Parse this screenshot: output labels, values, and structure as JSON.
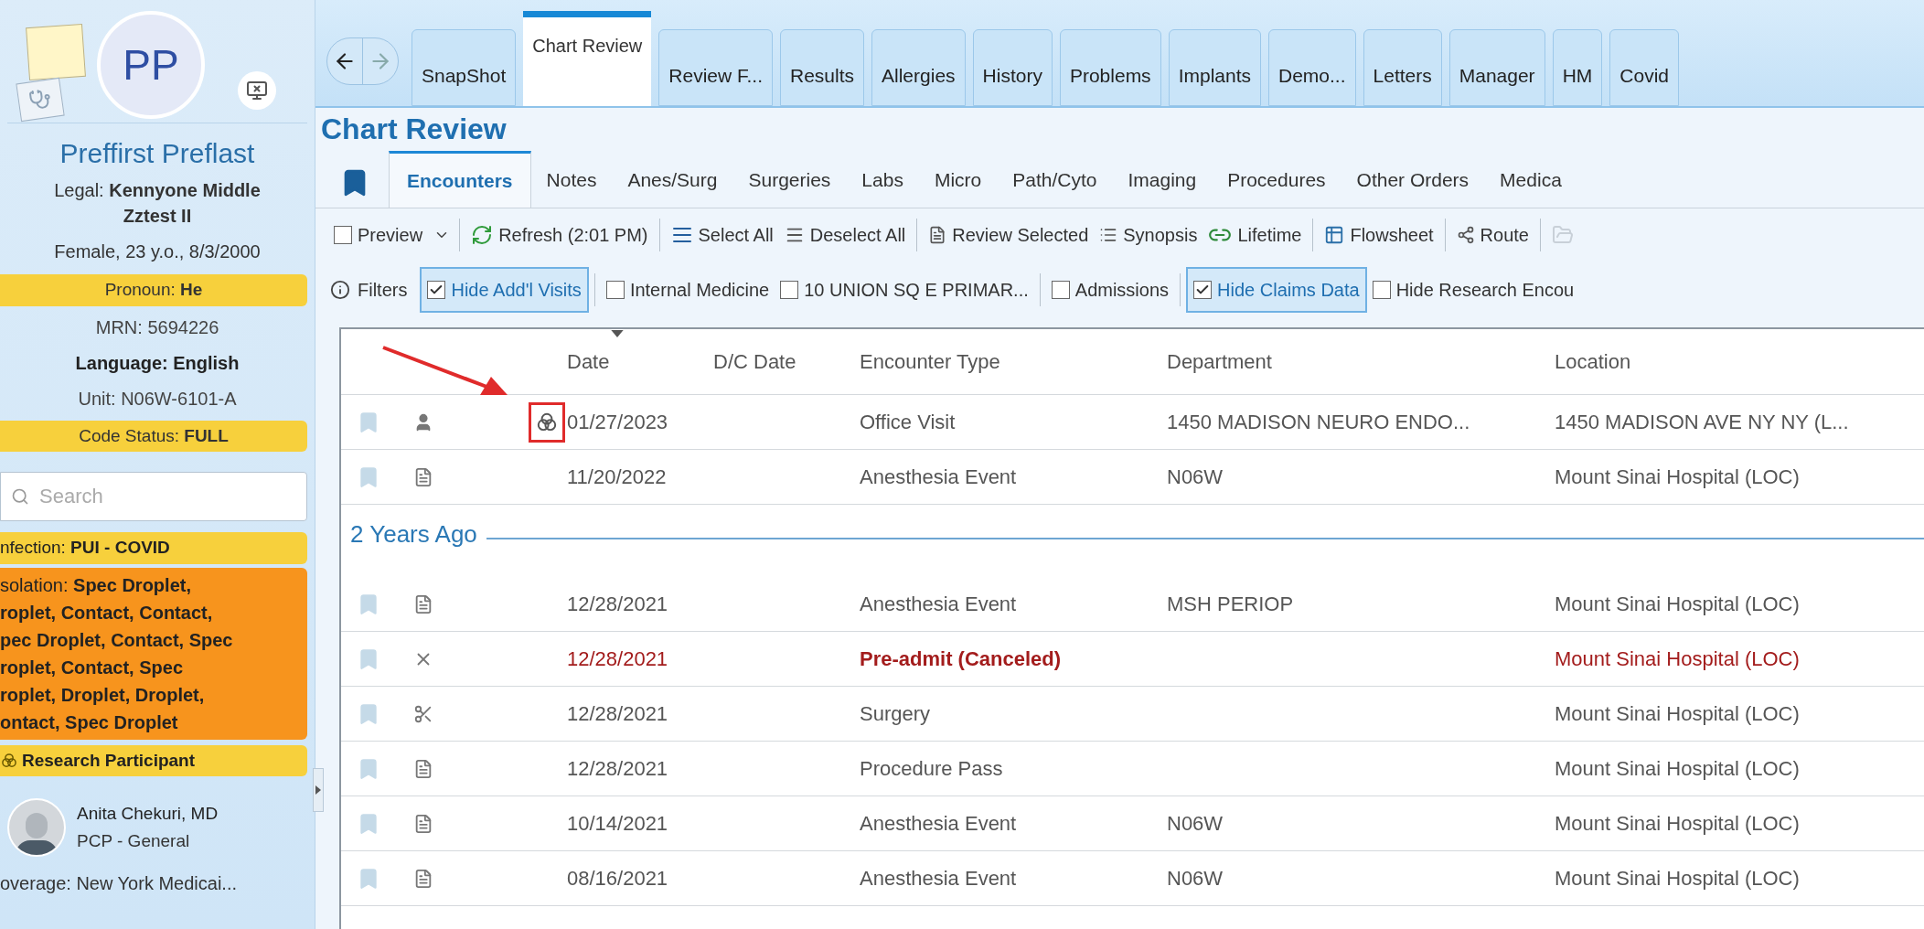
{
  "patient": {
    "initials": "PP",
    "name": "Preffirst Preflast",
    "legal": "Legal: **Kennyone Middle Zztest II**",
    "demographics": "Female, 23 y.o., 8/3/2000",
    "pronoun": "Pronoun: **He**",
    "mrn": "MRN: 5694226",
    "language": "Language: English",
    "unit": "Unit: N06W-6101-A",
    "code_status": "Code Status: **FULL**"
  },
  "search": {
    "placeholder": "Search"
  },
  "infection": "nfection: **PUI - COVID**",
  "isolation_lines": [
    "solation: **Spec Droplet,**",
    "**roplet, Contact, Contact,**",
    "**pec Droplet, Contact, Spec**",
    "**roplet, Contact, Spec**",
    "**roplet, Droplet, Droplet,**",
    "**ontact, Spec Droplet**"
  ],
  "research_badge": "Research Participant",
  "pcp": {
    "name": "Anita Chekuri, MD",
    "role": "PCP - General"
  },
  "coverage": "overage: New York Medicai...",
  "tabs": [
    {
      "label": "SnapShot",
      "selected": false
    },
    {
      "label": "Chart Review",
      "selected": true
    },
    {
      "label": "Review F...",
      "selected": false
    },
    {
      "label": "Results",
      "selected": false
    },
    {
      "label": "Allergies",
      "selected": false
    },
    {
      "label": "History",
      "selected": false
    },
    {
      "label": "Problems",
      "selected": false
    },
    {
      "label": "Implants",
      "selected": false
    },
    {
      "label": "Demo...",
      "selected": false
    },
    {
      "label": "Letters",
      "selected": false
    },
    {
      "label": "Manager",
      "selected": false
    },
    {
      "label": "HM",
      "selected": false
    },
    {
      "label": "Covid",
      "selected": false
    }
  ],
  "page_title": "Chart Review",
  "subtabs": [
    {
      "label": "Encounters",
      "selected": true
    },
    {
      "label": "Notes",
      "selected": false
    },
    {
      "label": "Anes/Surg",
      "selected": false
    },
    {
      "label": "Surgeries",
      "selected": false
    },
    {
      "label": "Labs",
      "selected": false
    },
    {
      "label": "Micro",
      "selected": false
    },
    {
      "label": "Path/Cyto",
      "selected": false
    },
    {
      "label": "Imaging",
      "selected": false
    },
    {
      "label": "Procedures",
      "selected": false
    },
    {
      "label": "Other Orders",
      "selected": false
    },
    {
      "label": "Medica",
      "selected": false
    }
  ],
  "toolbar": [
    [
      {
        "kind": "checkbox",
        "label": "Preview",
        "checked": false
      }
    ],
    [
      {
        "kind": "refresh",
        "label": "Refresh (2:01 PM)"
      }
    ],
    [
      {
        "kind": "select",
        "label": "Select All"
      },
      {
        "kind": "deselect",
        "label": "Deselect All"
      }
    ],
    [
      {
        "kind": "review",
        "label": "Review Selected"
      },
      {
        "kind": "synopsis",
        "label": "Synopsis"
      },
      {
        "kind": "lifetime",
        "label": "Lifetime"
      }
    ],
    [
      {
        "kind": "flowsheet",
        "label": "Flowsheet"
      }
    ],
    [
      {
        "kind": "route",
        "label": "Route"
      }
    ],
    [
      {
        "kind": "faded"
      }
    ]
  ],
  "filters_label": "Filters",
  "filters": [
    [
      {
        "label": "Hide Add'l Visits",
        "checked": true
      }
    ],
    [
      {
        "label": "Internal Medicine",
        "checked": false
      },
      {
        "label": "10 UNION SQ E PRIMAR...",
        "checked": false
      }
    ],
    [
      {
        "label": "Admissions",
        "checked": false
      }
    ],
    [
      {
        "label": "Hide Claims Data",
        "checked": true
      },
      {
        "label": "Hide Research Encou",
        "checked": false
      }
    ]
  ],
  "table": {
    "columns": [
      "Date",
      "D/C Date",
      "Encounter Type",
      "Department",
      "Location"
    ],
    "rows": [
      {
        "kind": "person",
        "research": true,
        "highlighted": true,
        "canceled": false,
        "date": "01/27/2023",
        "type": "Office Visit",
        "department": "1450 MADISON NEURO ENDO...",
        "location": "1450 MADISON AVE NY NY (L..."
      },
      {
        "kind": "document",
        "research": false,
        "highlighted": false,
        "canceled": false,
        "date": "11/20/2022",
        "type": "Anesthesia Event",
        "department": "N06W",
        "location": "Mount Sinai Hospital (LOC)"
      },
      {
        "kind": "group",
        "label": "2 Years Ago"
      },
      {
        "kind": "document",
        "research": false,
        "highlighted": false,
        "canceled": false,
        "date": "12/28/2021",
        "type": "Anesthesia Event",
        "department": "MSH PERIOP",
        "location": "Mount Sinai Hospital (LOC)"
      },
      {
        "kind": "cross",
        "research": false,
        "highlighted": false,
        "canceled": true,
        "date": "12/28/2021",
        "type": "Pre-admit (Canceled)",
        "location": "Mount Sinai Hospital (LOC)"
      },
      {
        "kind": "scissors",
        "research": false,
        "highlighted": false,
        "canceled": false,
        "date": "12/28/2021",
        "type": "Surgery",
        "location": "Mount Sinai Hospital (LOC)"
      },
      {
        "kind": "document",
        "research": false,
        "highlighted": false,
        "canceled": false,
        "date": "12/28/2021",
        "type": "Procedure Pass",
        "location": "Mount Sinai Hospital (LOC)"
      },
      {
        "kind": "document",
        "research": false,
        "highlighted": false,
        "canceled": false,
        "date": "10/14/2021",
        "type": "Anesthesia Event",
        "department": "N06W",
        "location": "Mount Sinai Hospital (LOC)"
      },
      {
        "kind": "document",
        "research": false,
        "highlighted": false,
        "canceled": false,
        "date": "08/16/2021",
        "type": "Anesthesia Event",
        "department": "N06W",
        "location": "Mount Sinai Hospital (LOC)"
      }
    ]
  }
}
